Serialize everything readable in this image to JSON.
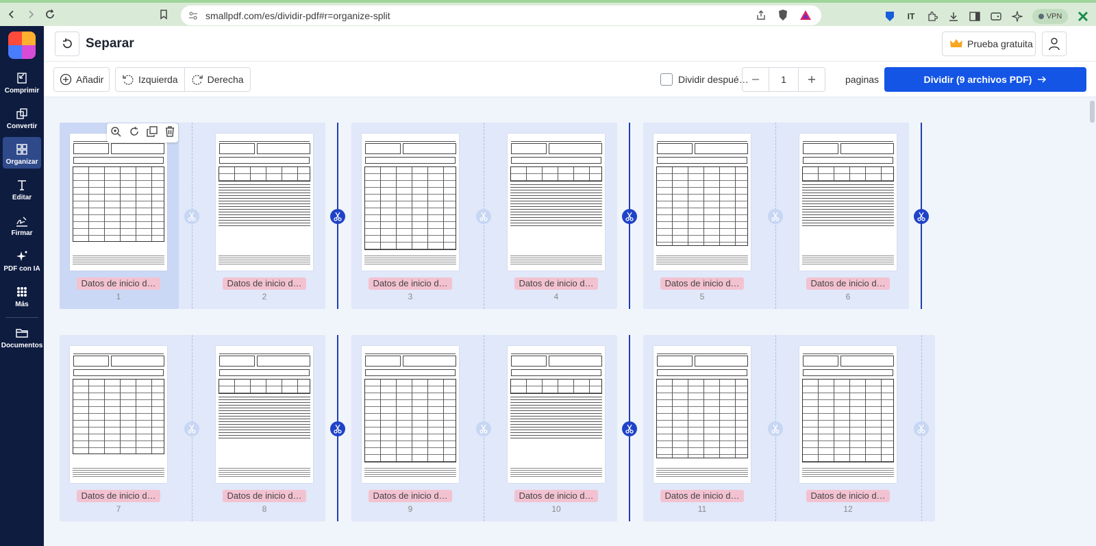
{
  "browser": {
    "url": "smallpdf.com/es/dividir-pdf#r=organize-split",
    "vpn_label": "VPN"
  },
  "sidebar": {
    "items": [
      {
        "label": "Comprimir",
        "icon": "compress-icon"
      },
      {
        "label": "Convertir",
        "icon": "convert-icon"
      },
      {
        "label": "Organizar",
        "icon": "organize-icon",
        "active": true
      },
      {
        "label": "Editar",
        "icon": "edit-text-icon"
      },
      {
        "label": "Firmar",
        "icon": "sign-icon"
      },
      {
        "label": "PDF con IA",
        "icon": "ai-sparkle-icon"
      },
      {
        "label": "Más",
        "icon": "more-grid-icon"
      },
      {
        "label": "Documentos",
        "icon": "folder-icon"
      }
    ]
  },
  "header": {
    "title": "Separar",
    "trial_label": "Prueba gratuita"
  },
  "toolbar": {
    "add_label": "Añadir",
    "rotate_left_label": "Izquierda",
    "rotate_right_label": "Derecha",
    "split_after_label": "Dividir despué…",
    "split_after_checked": false,
    "pages_value": "1",
    "pages_label": "paginas",
    "split_button_label": "Dividir (9 archivos PDF)"
  },
  "pages": [
    {
      "number": "1",
      "name": "Datos de inicio d…",
      "layout": "table",
      "selected": true
    },
    {
      "number": "2",
      "name": "Datos de inicio d…",
      "layout": "list"
    },
    {
      "number": "3",
      "name": "Datos de inicio d…",
      "layout": "table"
    },
    {
      "number": "4",
      "name": "Datos de inicio d…",
      "layout": "list"
    },
    {
      "number": "5",
      "name": "Datos de inicio d…",
      "layout": "table"
    },
    {
      "number": "6",
      "name": "Datos de inicio d…",
      "layout": "list"
    },
    {
      "number": "7",
      "name": "Datos de inicio d…",
      "layout": "table"
    },
    {
      "number": "8",
      "name": "Datos de inicio d…",
      "layout": "list"
    },
    {
      "number": "9",
      "name": "Datos de inicio d…",
      "layout": "table"
    },
    {
      "number": "10",
      "name": "Datos de inicio d…",
      "layout": "list"
    },
    {
      "number": "11",
      "name": "Datos de inicio d…",
      "layout": "table"
    },
    {
      "number": "12",
      "name": "Datos de inicio d…",
      "layout": "table"
    }
  ],
  "splits_after_pages": [
    "2",
    "4",
    "6",
    "8",
    "10"
  ],
  "colors": {
    "brand_blue": "#1455e6",
    "sidebar_bg": "#0e1c40",
    "split_active": "#1f43c8",
    "name_tag": "#f3c2d1"
  }
}
